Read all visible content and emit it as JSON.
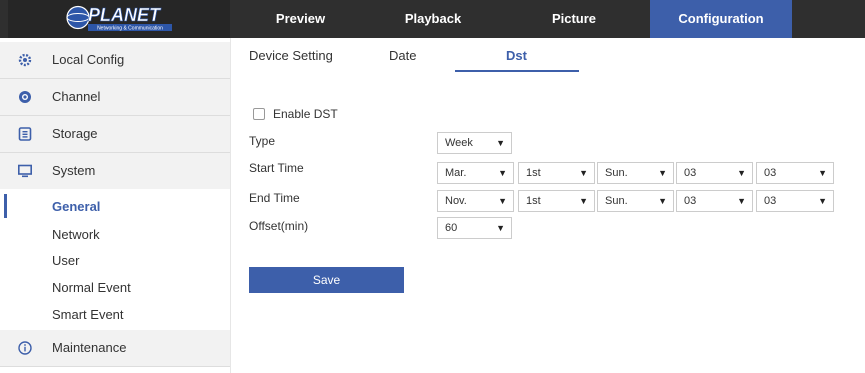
{
  "logo": {
    "brand": "PLANET",
    "tagline": "Networking & Communication"
  },
  "nav": [
    {
      "label": "Preview",
      "active": false
    },
    {
      "label": "Playback",
      "active": false
    },
    {
      "label": "Picture",
      "active": false
    },
    {
      "label": "Configuration",
      "active": true
    }
  ],
  "sidebar": {
    "items": [
      {
        "label": "Local Config",
        "icon": "gear-icon"
      },
      {
        "label": "Channel",
        "icon": "camera-icon"
      },
      {
        "label": "Storage",
        "icon": "storage-icon"
      },
      {
        "label": "System",
        "icon": "monitor-icon"
      },
      {
        "label": "Maintenance",
        "icon": "info-icon"
      }
    ],
    "subitems": [
      {
        "label": "General",
        "active": true
      },
      {
        "label": "Network",
        "active": false
      },
      {
        "label": "User",
        "active": false
      },
      {
        "label": "Normal Event",
        "active": false
      },
      {
        "label": "Smart Event",
        "active": false
      }
    ]
  },
  "tabs": [
    {
      "label": "Device Setting",
      "active": false
    },
    {
      "label": "Date",
      "active": false
    },
    {
      "label": "Dst",
      "active": true
    }
  ],
  "form": {
    "enable_dst_label": "Enable DST",
    "enable_dst_checked": false,
    "type_label": "Type",
    "type_value": "Week",
    "start_label": "Start Time",
    "start": {
      "month": "Mar.",
      "week": "1st",
      "day": "Sun.",
      "hour": "03",
      "minute": "03"
    },
    "end_label": "End Time",
    "end": {
      "month": "Nov.",
      "week": "1st",
      "day": "Sun.",
      "hour": "03",
      "minute": "03"
    },
    "offset_label": "Offset(min)",
    "offset_value": "60",
    "save_label": "Save"
  },
  "colors": {
    "accent": "#3d5faa",
    "topbar": "#2f2f2f",
    "sidebar_item_bg": "#f2f2f2"
  }
}
